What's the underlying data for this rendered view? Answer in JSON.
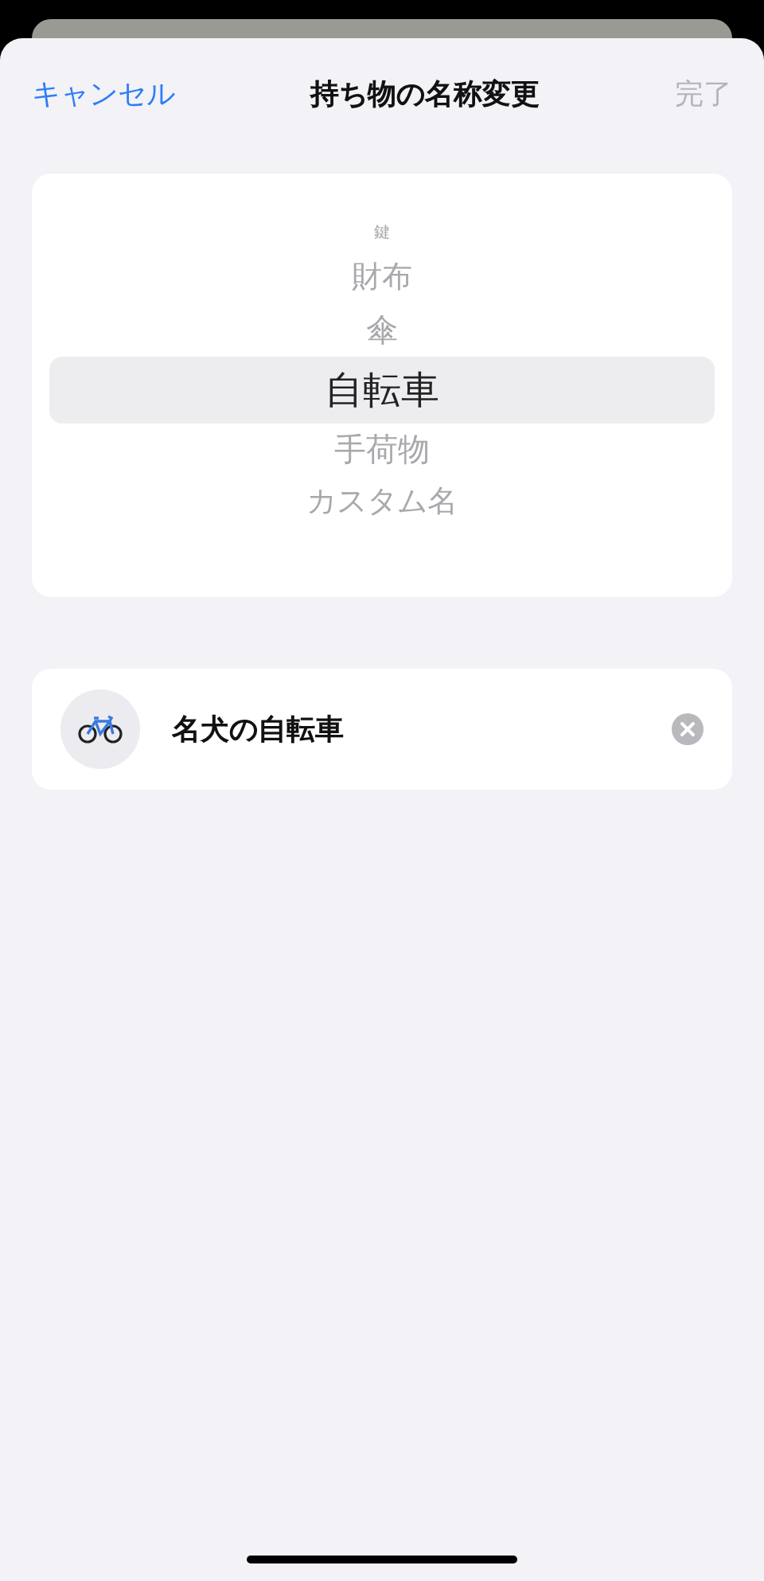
{
  "nav": {
    "cancel": "キャンセル",
    "title": "持ち物の名称変更",
    "done": "完了",
    "done_disabled": true
  },
  "picker": {
    "items": [
      {
        "label": "鍵",
        "selected": false
      },
      {
        "label": "財布",
        "selected": false
      },
      {
        "label": "傘",
        "selected": false
      },
      {
        "label": "自転車",
        "selected": true
      },
      {
        "label": "手荷物",
        "selected": false
      },
      {
        "label": "カスタム名",
        "selected": false
      }
    ]
  },
  "name_field": {
    "value": "名犬の自転車"
  }
}
